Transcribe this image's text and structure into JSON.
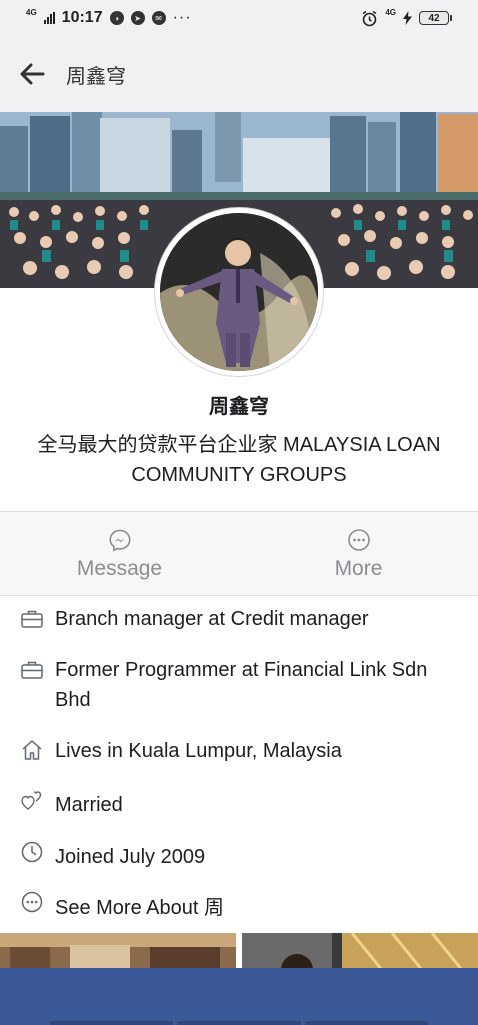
{
  "status_bar": {
    "network": "4G",
    "time": "10:17",
    "overflow": "···",
    "network_right": "4G",
    "battery": "42"
  },
  "header": {
    "title": "周鑫穹"
  },
  "profile": {
    "name": "周鑫穹",
    "bio": "全马最大的贷款平台企业家 MALAYSIA LOAN COMMUNITY GROUPS"
  },
  "actions": [
    {
      "label": "Message",
      "icon": "messenger-icon"
    },
    {
      "label": "More",
      "icon": "more-icon"
    }
  ],
  "intro": [
    {
      "text": "Branch manager at Credit manager",
      "icon": "briefcase-icon"
    },
    {
      "text": "Former Programmer at Financial Link Sdn Bhd",
      "icon": "briefcase-icon"
    },
    {
      "text": "Lives in Kuala Lumpur, Malaysia",
      "icon": "home-icon"
    },
    {
      "text": "Married",
      "icon": "hearts-icon"
    },
    {
      "text": "Joined July 2009",
      "icon": "clock-icon"
    },
    {
      "text": "See More About 周",
      "icon": "more-circle-icon"
    }
  ],
  "colors": {
    "brand": "#3b5998",
    "header_bg": "#f1f1f3",
    "muted_text": "#8a8d91"
  }
}
